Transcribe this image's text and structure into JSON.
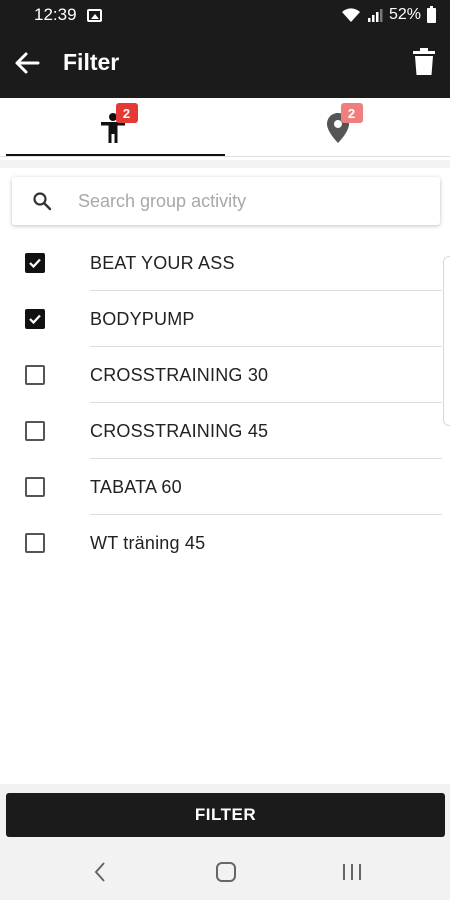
{
  "status_bar": {
    "time": "12:39",
    "battery": "52%",
    "icons": [
      "gallery-icon",
      "wifi-icon",
      "signal-icon",
      "battery-icon"
    ]
  },
  "app_bar": {
    "title": "Filter",
    "back_icon": "arrow-left-icon",
    "delete_icon": "trash-icon"
  },
  "tabs": [
    {
      "icon": "person-icon",
      "badge": "2",
      "active": true
    },
    {
      "icon": "location-pin-icon",
      "badge": "2",
      "active": false
    }
  ],
  "search": {
    "placeholder": "Search group activity",
    "value": ""
  },
  "activities": [
    {
      "label": "BEAT YOUR ASS",
      "checked": true
    },
    {
      "label": "BODYPUMP",
      "checked": true
    },
    {
      "label": "CROSSTRAINING 30",
      "checked": false
    },
    {
      "label": "CROSSTRAINING 45",
      "checked": false
    },
    {
      "label": "TABATA 60",
      "checked": false
    },
    {
      "label": "WT träning 45",
      "checked": false
    }
  ],
  "footer": {
    "filter_label": "FILTER"
  },
  "nav_bar": [
    "back-nav-icon",
    "home-nav-icon",
    "recents-nav-icon"
  ],
  "colors": {
    "app_bar": "#1b1b1b",
    "badge_active": "#e53935",
    "badge_inactive": "#ef7f7f"
  }
}
